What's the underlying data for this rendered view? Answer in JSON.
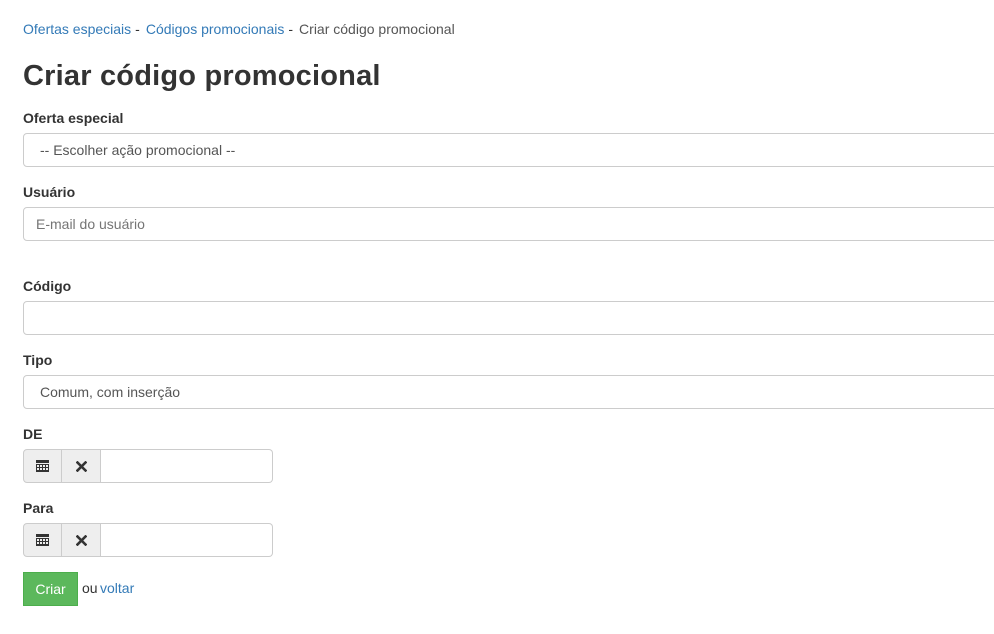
{
  "breadcrumb": {
    "items": [
      "Ofertas especiais",
      "Códigos promocionais"
    ],
    "separator": "-",
    "current": "Criar código promocional"
  },
  "page": {
    "title": "Criar código promocional"
  },
  "form": {
    "offer": {
      "label": "Oferta especial",
      "value": "-- Escolher ação promocional --"
    },
    "user": {
      "label": "Usuário",
      "placeholder": "E-mail do usuário",
      "value": ""
    },
    "code": {
      "label": "Código",
      "value": ""
    },
    "type": {
      "label": "Tipo",
      "value": "Comum, com inserção"
    },
    "from": {
      "label": "DE",
      "value": ""
    },
    "to": {
      "label": "Para",
      "value": ""
    }
  },
  "icons": {
    "calendar": "calendar-icon",
    "clear": "close-icon"
  },
  "actions": {
    "create_label": "Criar",
    "or_text": "ou",
    "back_label": "voltar"
  },
  "colors": {
    "link": "#337ab7",
    "primary_button": "#5cb85c"
  }
}
